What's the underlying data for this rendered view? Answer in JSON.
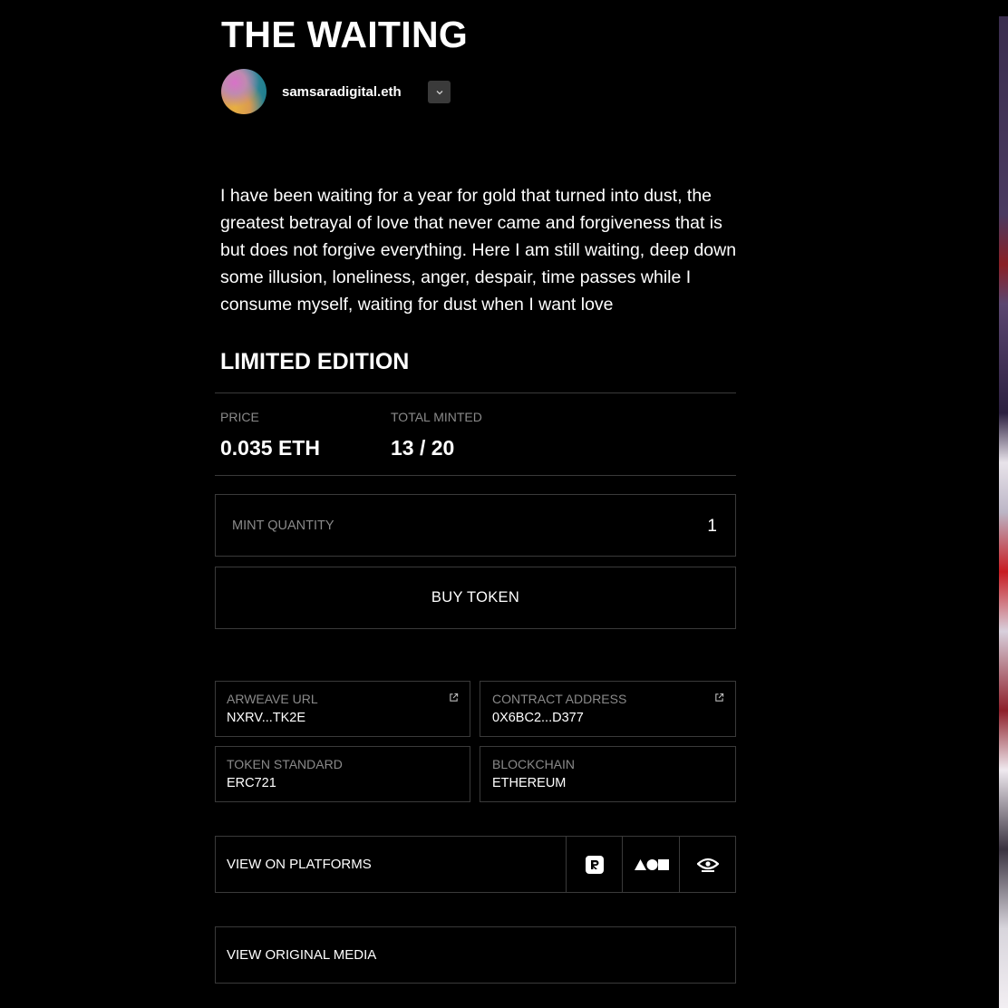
{
  "title": "THE WAITING",
  "creator": {
    "name": "samsaradigital.eth"
  },
  "description": "I have been waiting for a year for gold that turned into dust, the greatest betrayal of love that never came and forgiveness that is but does not forgive everything. Here I am still waiting, deep down some illusion, loneliness, anger, despair, time passes while I consume myself, waiting for dust when I want love",
  "edition": {
    "heading": "LIMITED EDITION",
    "price_label": "PRICE",
    "price_value": "0.035 ETH",
    "minted_label": "TOTAL MINTED",
    "minted_value": "13 / 20",
    "minted_fraction": 0.65
  },
  "mint": {
    "label": "MINT QUANTITY",
    "value": "1"
  },
  "buy_label": "BUY TOKEN",
  "info": [
    {
      "label": "ARWEAVE URL",
      "value": "NXRV...TK2E",
      "external": true
    },
    {
      "label": "CONTRACT ADDRESS",
      "value": "0X6BC2...D377",
      "external": true
    },
    {
      "label": "TOKEN STANDARD",
      "value": "ERC721"
    },
    {
      "label": "BLOCKCHAIN",
      "value": "ETHEREUM"
    }
  ],
  "platforms": {
    "label": "VIEW ON PLATFORMS",
    "icons": [
      "rarible-icon",
      "foundation-icon",
      "eye-icon"
    ]
  },
  "media_label": "VIEW ORIGINAL MEDIA",
  "colors": {
    "background": "#000000",
    "text": "#ffffff",
    "muted": "#8a8a8a",
    "border": "#3a3a3a",
    "button": "#3a3a3a"
  }
}
